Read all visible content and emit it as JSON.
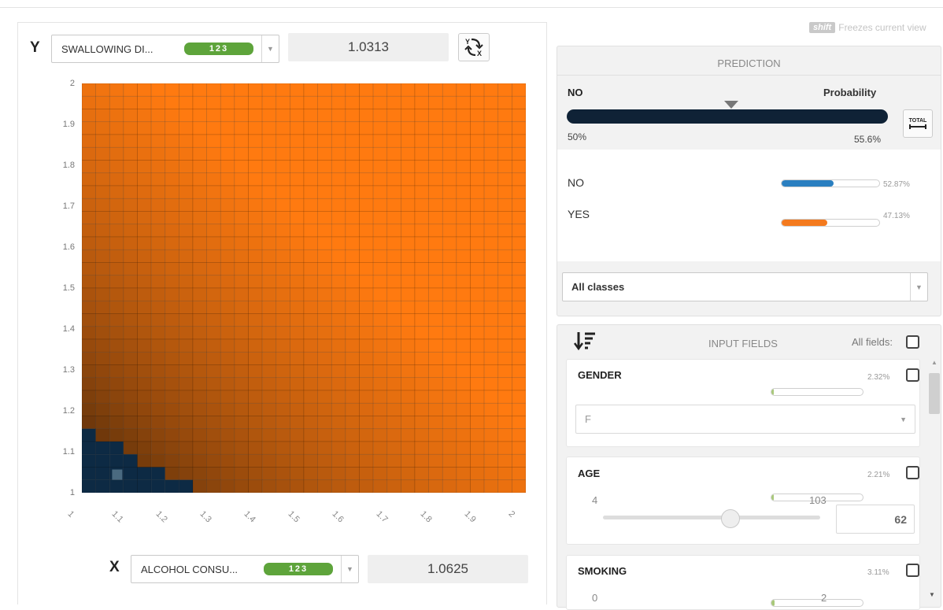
{
  "top_hint": {
    "key": "shift",
    "text": "Freezes current view"
  },
  "y_axis": {
    "letter": "Y",
    "field": "SWALLOWING DI...",
    "badge": "123",
    "value": "1.0313"
  },
  "x_axis": {
    "letter": "X",
    "field": "ALCOHOL CONSU...",
    "badge": "123",
    "value": "1.0625"
  },
  "swap_icon_label": "swap-axes",
  "heatmap": {
    "y_ticks": [
      "2",
      "1.9",
      "1.8",
      "1.7",
      "1.6",
      "1.5",
      "1.4",
      "1.3",
      "1.2",
      "1.1",
      "1"
    ],
    "x_ticks": [
      "1",
      "1.1",
      "1.2",
      "1.3",
      "1.4",
      "1.5",
      "1.6",
      "1.7",
      "1.8",
      "1.9",
      "2"
    ],
    "colors": {
      "high": "#ff7a10",
      "low": "#1d1208",
      "class_no": "#0d2a44"
    }
  },
  "prediction": {
    "header": "PREDICTION",
    "label": "NO",
    "probability_label": "Probability",
    "min": "50%",
    "max": "55.6%",
    "total_label": "TOTAL",
    "classes": [
      {
        "name": "NO",
        "pct": "52.87%",
        "value": 0.5287,
        "color": "#2a7fc0"
      },
      {
        "name": "YES",
        "pct": "47.13%",
        "value": 0.4713,
        "color": "#f47a1e"
      }
    ],
    "select_value": "All classes"
  },
  "inputs": {
    "header": "INPUT FIELDS",
    "all_fields_label": "All fields:",
    "fields": [
      {
        "name": "GENDER",
        "pct": "2.32%",
        "value": 0.0232,
        "select": "F"
      },
      {
        "name": "AGE",
        "pct": "2.21%",
        "value": 0.0221,
        "min": "4",
        "max": "103",
        "current": "62"
      },
      {
        "name": "SMOKING",
        "pct": "3.11%",
        "value": 0.0311,
        "min": "0",
        "max": "2"
      }
    ]
  }
}
